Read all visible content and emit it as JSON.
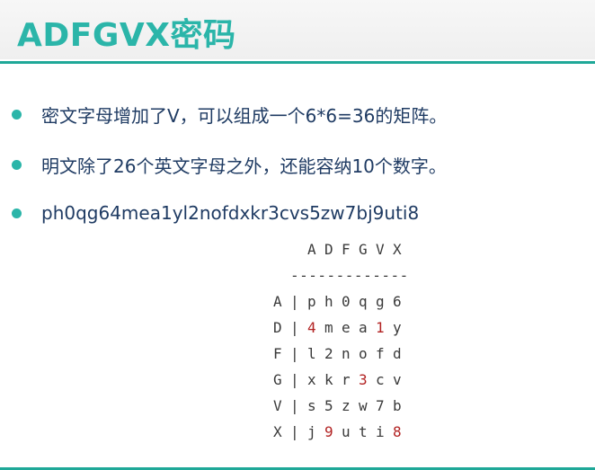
{
  "title": "ADFGVX密码",
  "bullets": [
    "密文字母增加了V，可以组成一个6*6=36的矩阵。",
    "明文除了26个英文字母之外，还能容纳10个数字。",
    "ph0qg64mea1yl2nofdxkr3cvs5zw7bj9uti8"
  ],
  "matrix": {
    "header": [
      "A",
      "D",
      "F",
      "G",
      "V",
      "X"
    ],
    "separator": "-------------",
    "rows": [
      {
        "key": "A",
        "cells": [
          "p",
          "h",
          "0",
          "q",
          "g",
          "6"
        ],
        "red": [
          false,
          false,
          false,
          false,
          false,
          false
        ]
      },
      {
        "key": "D",
        "cells": [
          "4",
          "m",
          "e",
          "a",
          "1",
          "y"
        ],
        "red": [
          true,
          false,
          false,
          false,
          true,
          false
        ]
      },
      {
        "key": "F",
        "cells": [
          "l",
          "2",
          "n",
          "o",
          "f",
          "d"
        ],
        "red": [
          false,
          false,
          false,
          false,
          false,
          false
        ]
      },
      {
        "key": "G",
        "cells": [
          "x",
          "k",
          "r",
          "3",
          "c",
          "v"
        ],
        "red": [
          false,
          false,
          false,
          true,
          false,
          false
        ]
      },
      {
        "key": "V",
        "cells": [
          "s",
          "5",
          "z",
          "w",
          "7",
          "b"
        ],
        "red": [
          false,
          false,
          false,
          false,
          false,
          false
        ]
      },
      {
        "key": "X",
        "cells": [
          "j",
          "9",
          "u",
          "t",
          "i",
          "8"
        ],
        "red": [
          false,
          true,
          false,
          false,
          false,
          true
        ]
      }
    ]
  },
  "colors": {
    "accent": "#2bb5a9",
    "text": "#1f3b63",
    "highlight": "#b22222"
  }
}
